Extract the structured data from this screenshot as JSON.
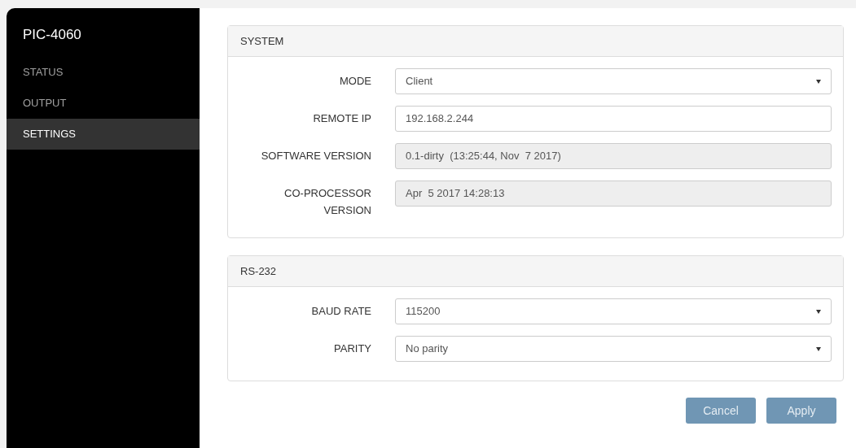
{
  "sidebar": {
    "title": "PIC-4060",
    "items": [
      {
        "label": "STATUS",
        "selected": false
      },
      {
        "label": "OUTPUT",
        "selected": false
      },
      {
        "label": "SETTINGS",
        "selected": true
      }
    ]
  },
  "panels": [
    {
      "title": "SYSTEM",
      "fields": [
        {
          "label": "MODE",
          "kind": "select",
          "value": "Client"
        },
        {
          "label": "REMOTE IP",
          "kind": "text",
          "value": "192.168.2.244"
        },
        {
          "label": "SOFTWARE VERSION",
          "kind": "readonly",
          "value": "0.1-dirty  (13:25:44, Nov  7 2017)"
        },
        {
          "label": "CO-PROCESSOR VERSION",
          "kind": "readonly",
          "value": "Apr  5 2017 14:28:13"
        }
      ]
    },
    {
      "title": "RS-232",
      "fields": [
        {
          "label": "BAUD RATE",
          "kind": "select",
          "value": "115200"
        },
        {
          "label": "PARITY",
          "kind": "select",
          "value": "No parity"
        }
      ]
    }
  ],
  "buttons": [
    {
      "label": "Cancel",
      "disabled": true
    },
    {
      "label": "Apply",
      "disabled": true
    }
  ]
}
